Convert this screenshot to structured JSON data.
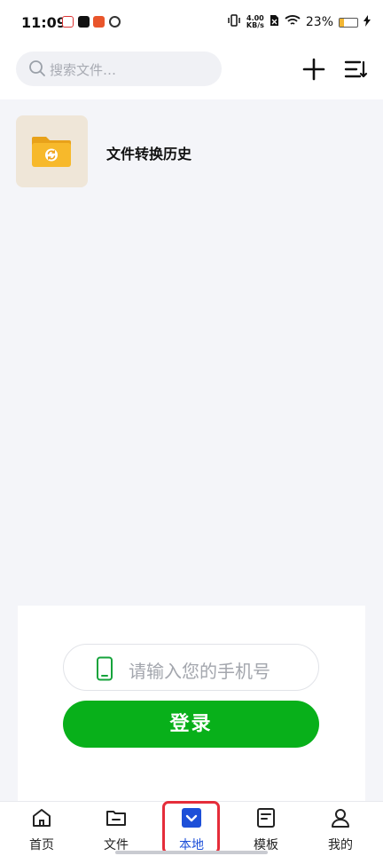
{
  "status_bar": {
    "time": "11:09",
    "speed_top": "4.00",
    "speed_bottom": "KB/s",
    "battery": "23%",
    "battery_level": 0.23
  },
  "header": {
    "search_placeholder": "搜索文件…"
  },
  "folder": {
    "label": "文件转换历史"
  },
  "login": {
    "phone_placeholder": "请输入您的手机号",
    "button_label": "登录"
  },
  "tabs": [
    {
      "label": "首页"
    },
    {
      "label": "文件"
    },
    {
      "label": "本地"
    },
    {
      "label": "模板"
    },
    {
      "label": "我的"
    }
  ],
  "colors": {
    "accent": "#1d4fd8",
    "login_green": "#08b01a",
    "highlight_red": "#e52d3a"
  }
}
